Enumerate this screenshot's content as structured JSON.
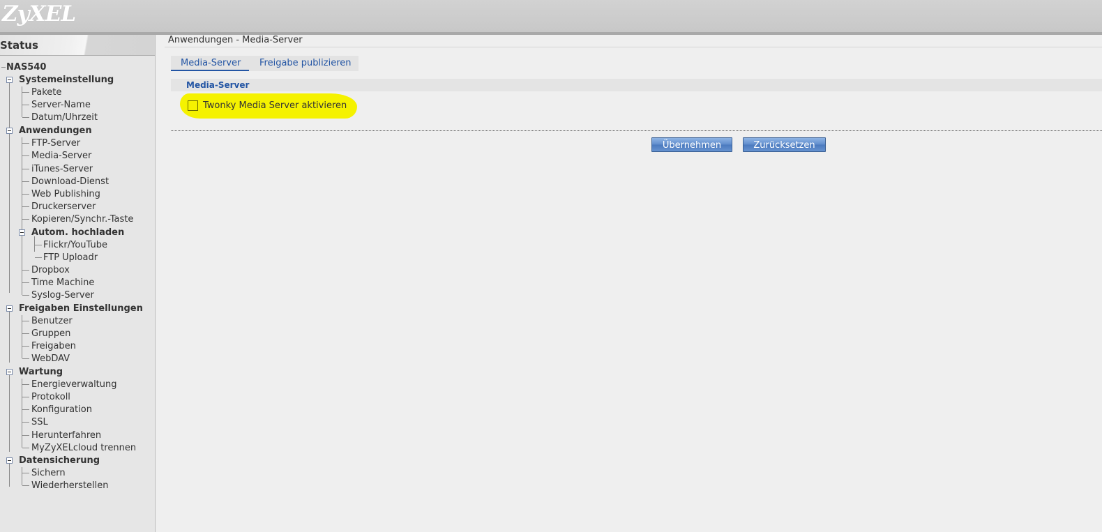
{
  "app": {
    "logo": "ZyXEL"
  },
  "sidebar": {
    "status_label": "Status",
    "device": "NAS540",
    "groups": [
      {
        "label": "Systemeinstellung",
        "items": [
          "Pakete",
          "Server-Name",
          "Datum/Uhrzeit"
        ]
      },
      {
        "label": "Anwendungen",
        "items": [
          "FTP-Server",
          "Media-Server",
          "iTunes-Server",
          "Download-Dienst",
          "Web Publishing",
          "Druckerserver",
          "Kopieren/Synchr.-Taste"
        ],
        "subgroup": {
          "label": "Autom. hochladen",
          "items": [
            "Flickr/YouTube",
            "FTP Uploadr"
          ]
        },
        "items_after": [
          "Dropbox",
          "Time Machine",
          "Syslog-Server"
        ]
      },
      {
        "label": "Freigaben Einstellungen",
        "items": [
          "Benutzer",
          "Gruppen",
          "Freigaben",
          "WebDAV"
        ]
      },
      {
        "label": "Wartung",
        "items": [
          "Energieverwaltung",
          "Protokoll",
          "Konfiguration",
          "SSL",
          "Herunterfahren",
          "MyZyXELcloud trennen"
        ]
      },
      {
        "label": "Datensicherung",
        "items": [
          "Sichern",
          "Wiederherstellen"
        ]
      }
    ]
  },
  "main": {
    "breadcrumb": "Anwendungen - Media-Server",
    "tabs": [
      {
        "label": "Media-Server",
        "active": true
      },
      {
        "label": "Freigabe publizieren",
        "active": false
      }
    ],
    "section_title": "Media-Server",
    "checkbox": {
      "label": "Twonky Media Server aktivieren",
      "checked": false
    },
    "apply_label": "Übernehmen",
    "reset_label": "Zurücksetzen"
  },
  "colors": {
    "accent": "#2355a4",
    "highlight": "#f5f200",
    "button": "#5f8ccc"
  }
}
